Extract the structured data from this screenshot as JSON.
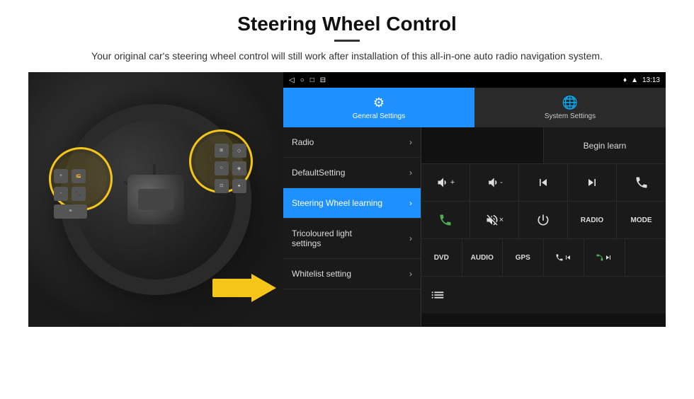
{
  "header": {
    "title": "Steering Wheel Control",
    "divider": true,
    "subtitle": "Your original car's steering wheel control will still work after installation of this all-in-one auto radio navigation system."
  },
  "statusBar": {
    "icons": [
      "◁",
      "○",
      "□",
      "⊟"
    ],
    "rightIcons": [
      "♥",
      "▲"
    ],
    "time": "13:13"
  },
  "tabs": [
    {
      "id": "general",
      "label": "General Settings",
      "active": true
    },
    {
      "id": "system",
      "label": "System Settings",
      "active": false
    }
  ],
  "menu": [
    {
      "id": "radio",
      "label": "Radio",
      "active": false
    },
    {
      "id": "default",
      "label": "DefaultSetting",
      "active": false
    },
    {
      "id": "steering",
      "label": "Steering Wheel learning",
      "active": true
    },
    {
      "id": "tricoloured",
      "label": "Tricoloured light settings",
      "active": false
    },
    {
      "id": "whitelist",
      "label": "Whitelist setting",
      "active": false
    }
  ],
  "controlPanel": {
    "beginLearnLabel": "Begin learn",
    "buttons": {
      "row1": [
        {
          "icon": "vol_up",
          "label": "🔊+"
        },
        {
          "icon": "vol_down",
          "label": "🔉-"
        },
        {
          "icon": "prev_track",
          "label": "⏮"
        },
        {
          "icon": "next_track",
          "label": "⏭"
        },
        {
          "icon": "phone",
          "label": "📞"
        }
      ],
      "row2": [
        {
          "icon": "phone_answer",
          "label": "📞"
        },
        {
          "icon": "mute",
          "label": "🔇"
        },
        {
          "icon": "power",
          "label": "⏻"
        },
        {
          "icon": "radio_mode",
          "label": "RADIO"
        },
        {
          "icon": "mode",
          "label": "MODE"
        }
      ],
      "row3": [
        {
          "icon": "dvd",
          "label": "DVD"
        },
        {
          "icon": "audio",
          "label": "AUDIO"
        },
        {
          "icon": "gps",
          "label": "GPS"
        },
        {
          "icon": "phone2",
          "label": "📞⏮"
        },
        {
          "icon": "next2",
          "label": "⏭📞"
        }
      ],
      "row4": [
        {
          "icon": "list",
          "label": "≡"
        }
      ]
    }
  }
}
